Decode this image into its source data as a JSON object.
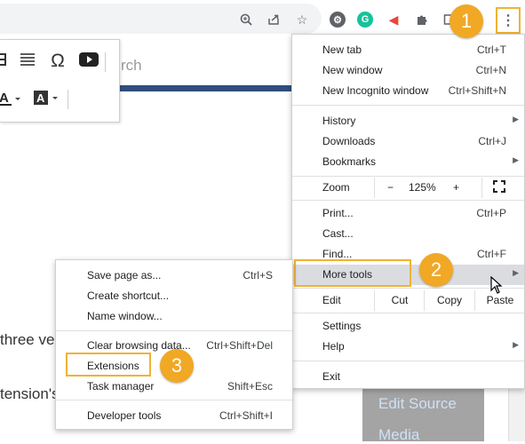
{
  "menu": {
    "new_tab": {
      "label": "New tab",
      "shortcut": "Ctrl+T"
    },
    "new_window": {
      "label": "New window",
      "shortcut": "Ctrl+N"
    },
    "new_incognito": {
      "label": "New Incognito window",
      "shortcut": "Ctrl+Shift+N"
    },
    "history": {
      "label": "History"
    },
    "downloads": {
      "label": "Downloads",
      "shortcut": "Ctrl+J"
    },
    "bookmarks": {
      "label": "Bookmarks"
    },
    "zoom": {
      "label": "Zoom",
      "minus": "−",
      "value": "125%",
      "plus": "+"
    },
    "print": {
      "label": "Print...",
      "shortcut": "Ctrl+P"
    },
    "cast": {
      "label": "Cast..."
    },
    "find": {
      "label": "Find...",
      "shortcut": "Ctrl+F"
    },
    "more_tools": {
      "label": "More tools"
    },
    "edit": {
      "label": "Edit",
      "cut": "Cut",
      "copy": "Copy",
      "paste": "Paste"
    },
    "settings": {
      "label": "Settings"
    },
    "help": {
      "label": "Help"
    },
    "exit": {
      "label": "Exit"
    }
  },
  "submenu": {
    "save_page": {
      "label": "Save page as...",
      "shortcut": "Ctrl+S"
    },
    "create_shortcut": {
      "label": "Create shortcut..."
    },
    "name_window": {
      "label": "Name window..."
    },
    "clear_data": {
      "label": "Clear browsing data...",
      "shortcut": "Ctrl+Shift+Del"
    },
    "extensions": {
      "label": "Extensions"
    },
    "task_manager": {
      "label": "Task manager",
      "shortcut": "Shift+Esc"
    },
    "developer_tools": {
      "label": "Developer tools",
      "shortcut": "Ctrl+Shift+I"
    }
  },
  "callouts": [
    "1",
    "2",
    "3"
  ],
  "background": {
    "search_placeholder": "rch",
    "text_line_1": "three ve",
    "text_line_2": "tension's",
    "side_link_1": "Edit Source",
    "side_link_2": "Media"
  },
  "icons": {
    "toolbar": [
      "zoom-icon",
      "share-icon",
      "bookmark-star-icon",
      "extension-gear-icon",
      "grammarly-icon",
      "megaphone-icon",
      "puzzle-icon",
      "sidepanel-icon",
      "kebab-menu-icon"
    ],
    "editor": [
      "table-icon",
      "align-icon",
      "omega-icon",
      "youtube-icon",
      "text-color-icon",
      "text-bg-icon"
    ]
  },
  "colors": {
    "accent": "#f1a825",
    "highlight_border": "#f0b234",
    "menu_hover": "#dadce0",
    "header_band": "#2f4e7e"
  }
}
